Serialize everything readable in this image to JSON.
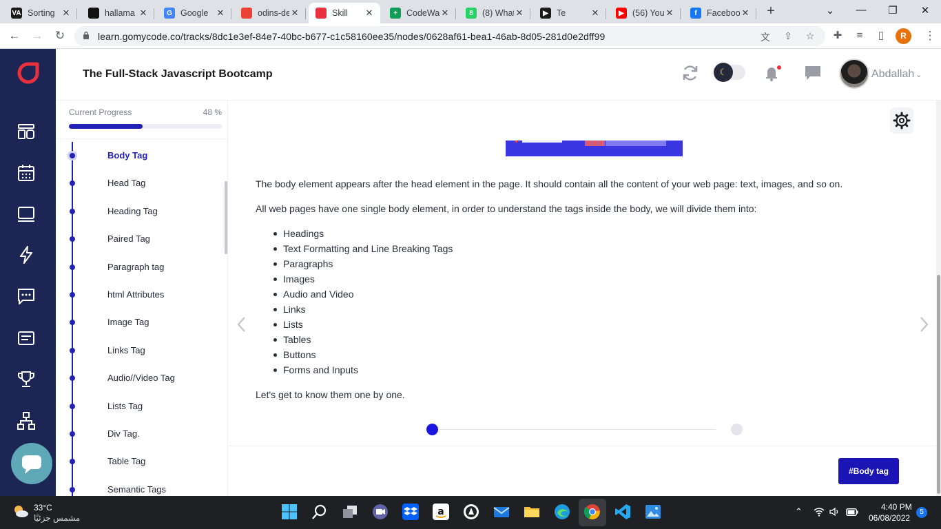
{
  "browser": {
    "tabs": [
      {
        "title": "Sorting",
        "icon": "va-icon",
        "color": "#1b1b1b",
        "glyph": "VA"
      },
      {
        "title": "hallama",
        "icon": "github-icon",
        "color": "#111111",
        "glyph": ""
      },
      {
        "title": "Google",
        "icon": "google-translate-icon",
        "color": "#4285f4",
        "glyph": "G"
      },
      {
        "title": "odins-de",
        "icon": "odin-icon",
        "color": "#ea4335",
        "glyph": ""
      },
      {
        "title": "Skill",
        "icon": "gomycode-icon",
        "color": "#e8313f",
        "glyph": ""
      },
      {
        "title": "CodeWa",
        "icon": "sheets-icon",
        "color": "#0f9d58",
        "glyph": "+"
      },
      {
        "title": "(8) What",
        "icon": "whatsapp-icon",
        "color": "#25d366",
        "glyph": "8"
      },
      {
        "title": "Te",
        "icon": "music-icon",
        "color": "#1b1b1b",
        "glyph": "▶"
      },
      {
        "title": "(56) You",
        "icon": "youtube-icon",
        "color": "#ff0000",
        "glyph": "▶"
      },
      {
        "title": "Faceboo",
        "icon": "facebook-icon",
        "color": "#1877f2",
        "glyph": "f"
      }
    ],
    "active_tab": 4,
    "new_tab": "+",
    "url": "learn.gomycode.co/tracks/8dc1e3ef-84e7-40bc-b677-c1c58160ee35/nodes/0628af61-bea1-46ab-8d05-281d0e2dff99",
    "profile_initial": "R"
  },
  "app": {
    "title": "The Full-Stack Javascript Bootcamp",
    "user_name": "Abdallah",
    "accent": "#2322b8",
    "brand": "#e8313f",
    "nav_icons": [
      "dashboard-icon",
      "calendar-icon",
      "laptop-icon",
      "lightning-icon",
      "chat-icon",
      "document-icon",
      "trophy-icon",
      "hierarchy-icon"
    ]
  },
  "sidebar": {
    "progress_label": "Current Progress",
    "progress_text": "48 %",
    "progress_fraction": 0.48,
    "lessons": [
      {
        "label": "Body Tag",
        "active": true
      },
      {
        "label": "Head Tag",
        "active": false
      },
      {
        "label": "Heading Tag",
        "active": false
      },
      {
        "label": "Paired Tag",
        "active": false
      },
      {
        "label": "Paragraph tag",
        "active": false
      },
      {
        "label": "html Attributes",
        "active": false
      },
      {
        "label": "Image Tag",
        "active": false
      },
      {
        "label": "Links Tag",
        "active": false
      },
      {
        "label": "Audio//Video Tag",
        "active": false
      },
      {
        "label": "Lists Tag",
        "active": false
      },
      {
        "label": "Div Tag.",
        "active": false
      },
      {
        "label": "Table Tag",
        "active": false
      },
      {
        "label": "Semantic Tags",
        "active": false
      }
    ]
  },
  "content": {
    "intro": "The body element appears after the head element in the page. It should contain all the content of your web page: text, images, and so on.",
    "lead": "All web pages have one single body element, in order to understand the tags inside the body, we will divide them into:",
    "items": [
      "Headings",
      "Text Formatting and Line Breaking Tags",
      "Paragraphs",
      "Images",
      "Audio and Video",
      "Links",
      "Lists",
      "Tables",
      "Buttons",
      "Forms and Inputs"
    ],
    "outro": "Let's get to know them one by one.",
    "slides_total": 2,
    "slide_current": 1,
    "tag_button": "#Body tag"
  },
  "taskbar": {
    "temperature": "33°C",
    "weather": "مشمس جزئيًا",
    "time": "4:40 PM",
    "date": "06/08/2022",
    "notifications": "5"
  }
}
